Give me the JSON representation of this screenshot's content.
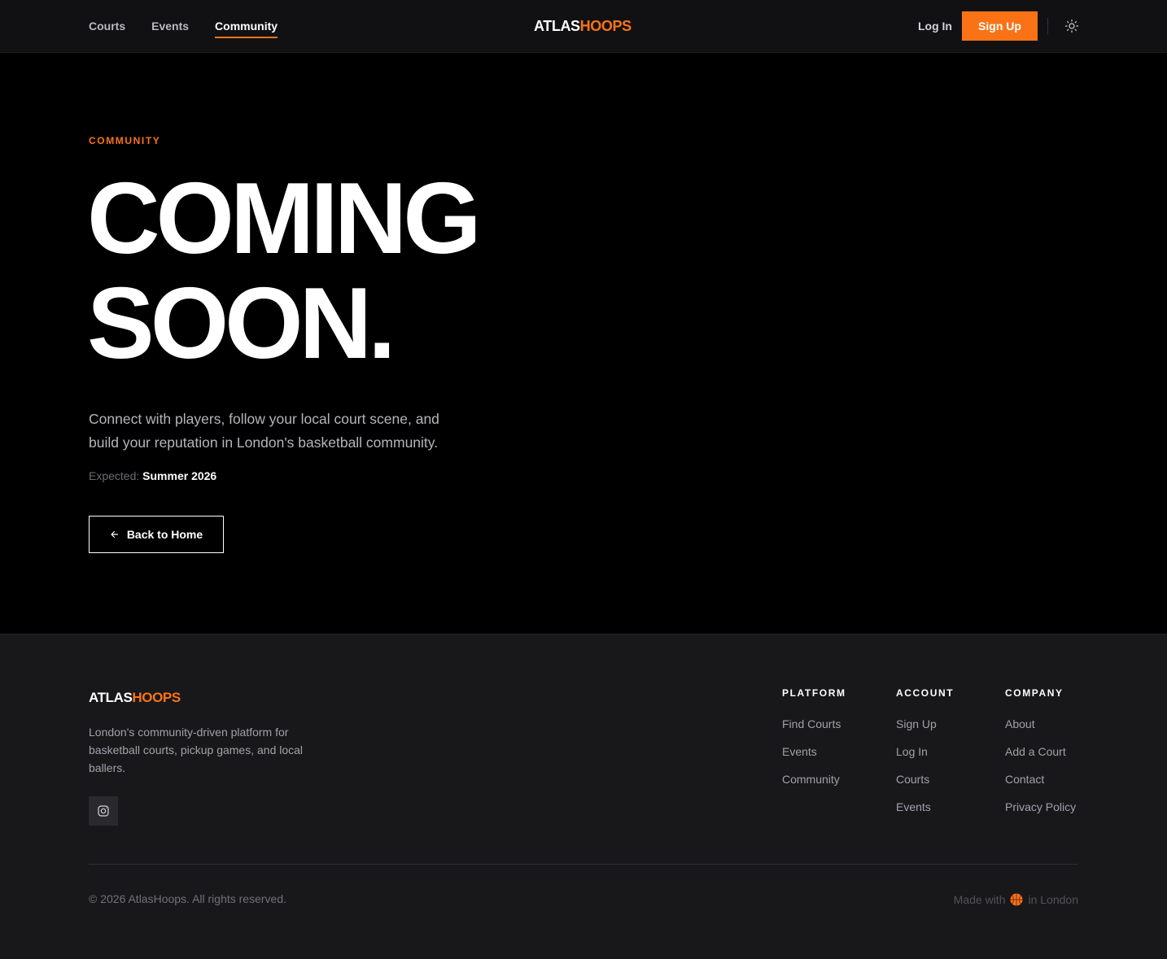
{
  "nav": {
    "links": [
      {
        "label": "Courts",
        "active": false
      },
      {
        "label": "Events",
        "active": false
      },
      {
        "label": "Community",
        "active": true
      }
    ],
    "logo_part1": "ATLAS",
    "logo_part2": "HOOPS",
    "login_label": "Log In",
    "signup_label": "Sign Up",
    "theme_toggle_icon": "sun-icon"
  },
  "hero": {
    "eyebrow": "COMMUNITY",
    "headline_line1": "COMING",
    "headline_line2": "SOON.",
    "description": "Connect with players, follow your local court scene, and build your reputation in London's basketball community.",
    "expected_label": "Expected:",
    "expected_value": "Summer 2026",
    "back_button_label": "Back to Home",
    "back_button_icon": "arrow-left-icon"
  },
  "footer": {
    "logo_part1": "ATLAS",
    "logo_part2": "HOOPS",
    "description": "London's community-driven platform for basketball courts, pickup games, and local ballers.",
    "social_icon": "instagram-icon",
    "columns": [
      {
        "heading": "PLATFORM",
        "links": [
          "Find Courts",
          "Events",
          "Community"
        ]
      },
      {
        "heading": "ACCOUNT",
        "links": [
          "Sign Up",
          "Log In",
          "Courts",
          "Events"
        ]
      },
      {
        "heading": "COMPANY",
        "links": [
          "About",
          "Add a Court",
          "Contact",
          "Privacy Policy"
        ]
      }
    ],
    "copyright": "© 2026 AtlasHoops. All rights reserved.",
    "made_with_prefix": "Made with",
    "made_with_icon": "basketball-icon",
    "made_with_suffix": "in London"
  },
  "colors": {
    "accent": "#f97316",
    "background": "#000000",
    "nav_background": "#111114",
    "footer_background": "#18181b"
  }
}
